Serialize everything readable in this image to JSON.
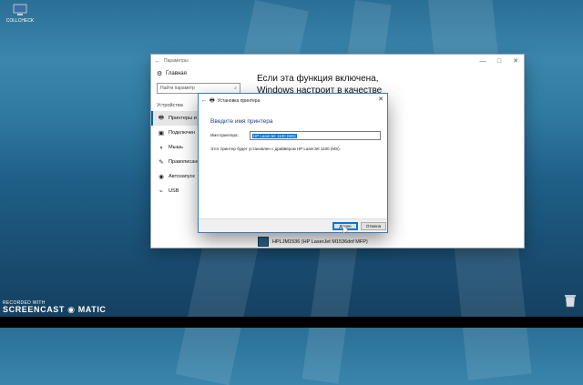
{
  "desktop": {
    "icons": [
      {
        "label": "COLLCHECK",
        "icon": "computer-icon"
      },
      {
        "label": "",
        "icon": "recycle-bin-icon"
      }
    ],
    "watermark": {
      "line1": "RECORDED WITH",
      "line2": "SCREENCAST",
      "line3": "MATIC"
    }
  },
  "settings": {
    "title": "Параметры",
    "controls": {
      "minimize": "—",
      "maximize": "□",
      "close": "✕"
    },
    "home": "Главная",
    "search_placeholder": "Найти параметр",
    "section": "Устройства",
    "nav": [
      {
        "label": "Принтеры и ска",
        "icon": "printer-icon",
        "active": true
      },
      {
        "label": "Подключен",
        "icon": "connected-devices-icon"
      },
      {
        "label": "Мышь",
        "icon": "mouse-icon"
      },
      {
        "label": "Правописание",
        "icon": "pen-icon"
      },
      {
        "label": "Автозапуск",
        "icon": "autoplay-icon"
      },
      {
        "label": "USB",
        "icon": "usb-icon"
      }
    ],
    "main_text": "Если эта функция включена, Windows настроит в качестве используемого по",
    "printer_entry": "HPLJM1536 (HP LaserJet M1536dnf MFP)"
  },
  "dialog": {
    "title": "Установка принтера",
    "close": "✕",
    "heading": "Введите имя принтера",
    "field_label": "Имя принтера:",
    "field_value": "HP LaserJet 1100 (MS)",
    "driver_note": "Этот принтер будет установлен с драйвером HP LaserJet 1100 (MS).",
    "next_button": "Далее",
    "cancel_button": "Отмена"
  }
}
